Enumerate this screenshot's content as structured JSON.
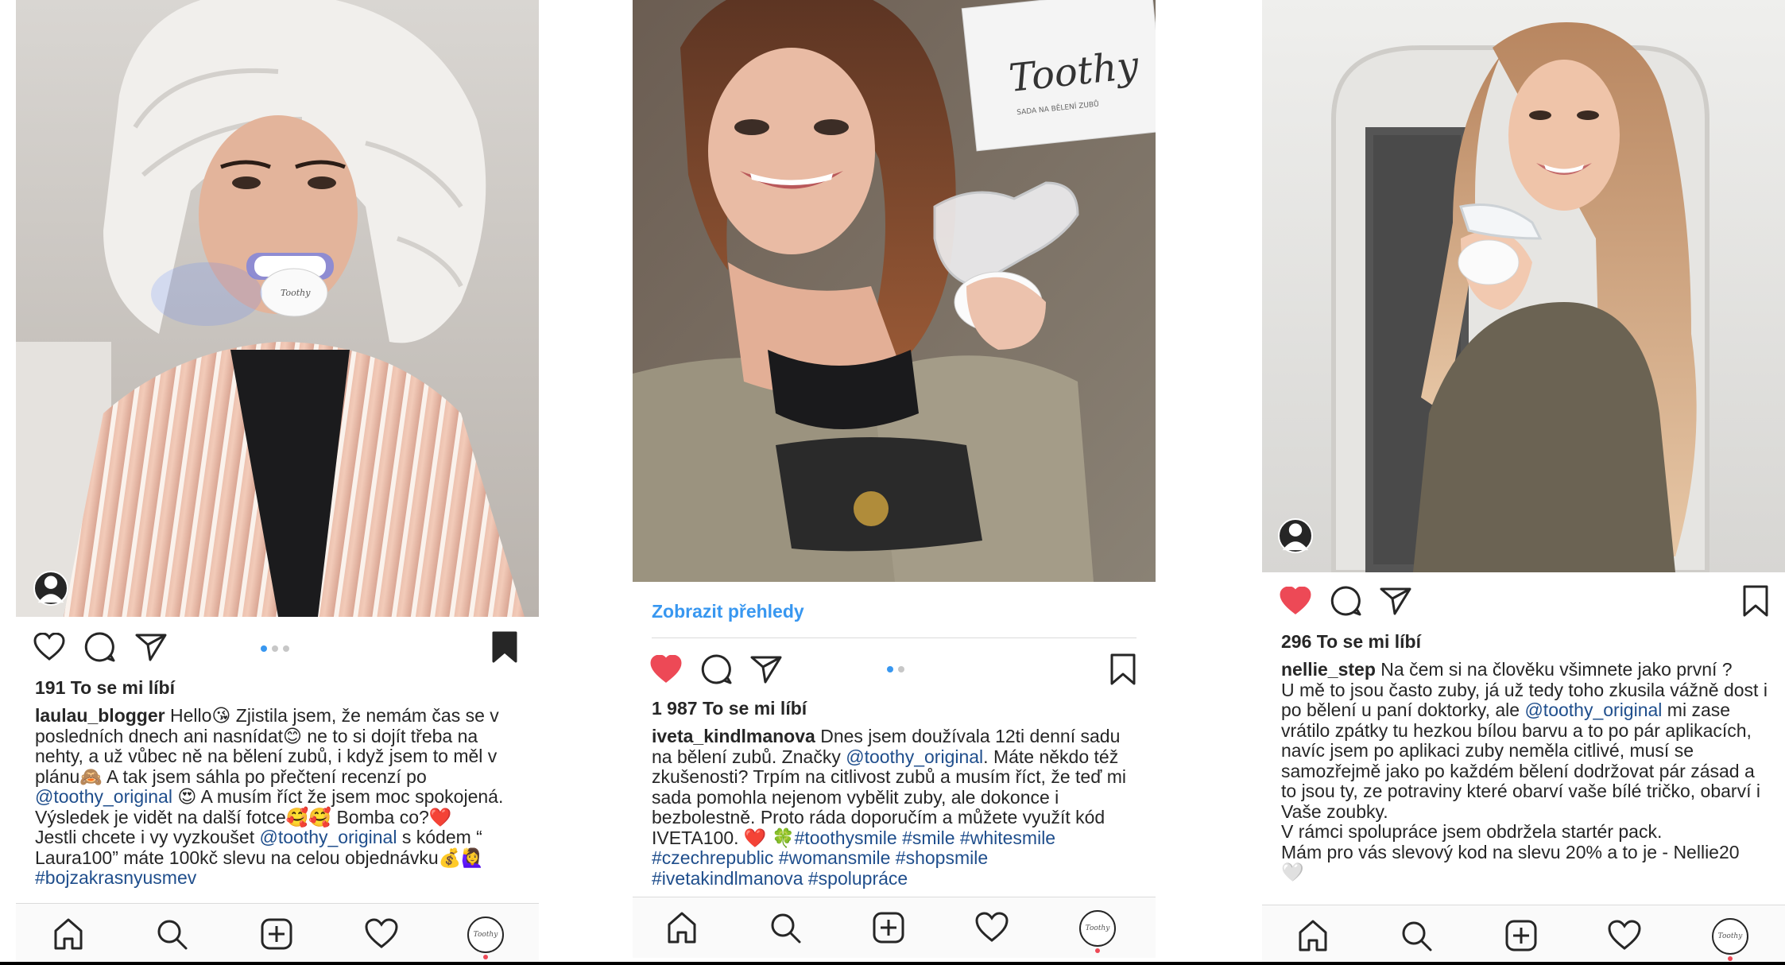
{
  "posts": [
    {
      "likes": "191 To se mi líbí",
      "username": "laulau_blogger",
      "caption_parts": [
        " Hello😘 Zjistila jsem, že nemám čas se v posledních dnech ani nasnídat😊 ne to si dojít třeba na nehty, a už vůbec ně na bělení zubů, i když jsem to měl v plánu🙈 A tak jsem sáhla po přečtení recenzí po ",
        "@toothy_original",
        " 😍 A musím říct že jsem moc spokojená. Výsledek je vidět na další fotce🥰🥰 Bomba co?❤️\nJestli chcete i vy vyzkoušet ",
        "@toothy_original",
        " s kódem “ Laura100” máte 100kč slevu na celou objednávku💰🙋‍♀️\n",
        "#bojzakrasnyusmev"
      ],
      "photo_label": "Toothy",
      "liked": false,
      "saved": true
    },
    {
      "insights_link": "Zobrazit přehledy",
      "likes": "1 987 To se mi líbí",
      "username": "iveta_kindlmanova",
      "caption_parts": [
        " Dnes jsem doužívala 12ti denní sadu na bělení zubů. Značky ",
        "@toothy_original",
        ". Máte někdo též zkušenosti? Trpím na citlivost zubů a musím říct, že teď mi sada pomohla nejenom vybělit zuby, ale dokonce i bezbolestně. Proto ráda doporučím a můžete využít kód IVETA100. ❤️ 🍀",
        "#toothysmile #smile #whitesmile\n#czechrepublic #womansmile #shopsmile\n#ivetakindlmanova #spolupráce"
      ],
      "box_brand": "Toothy",
      "box_subtitle": "SADA NA BĚLENÍ ZUBŮ",
      "liked": true,
      "saved": false
    },
    {
      "likes": "296 To se mi líbí",
      "username": "nellie_step",
      "caption_parts": [
        " Na čem si na člověku všimnete jako první ?\nU mě to jsou často zuby, já už tedy toho zkusila vážně dost i po bělení u paní doktorky, ale ",
        "@toothy_original",
        " mi zase vrátilo zpátky tu hezkou bílou barvu a to po pár aplikacích, navíc jsem po aplikaci zuby neměla citlivé, musí se samozřejmě jako po každém bělení dodržovat pár zásad a to jsou ty, ze potraviny které obarví vaše bílé tričko, obarví i Vaše zoubky.\nV rámci spolupráce jsem obdržela startér pack.\nMám pro vás slevový kod na slevu 20% a to je - Nellie20\n🤍"
      ],
      "liked": true,
      "saved": false
    }
  ],
  "nav_profile_label": "Toothy",
  "colors": {
    "like_red": "#ed4956",
    "link_blue": "#3897f0",
    "mention_blue": "#1f4e8c",
    "text": "#262626"
  }
}
